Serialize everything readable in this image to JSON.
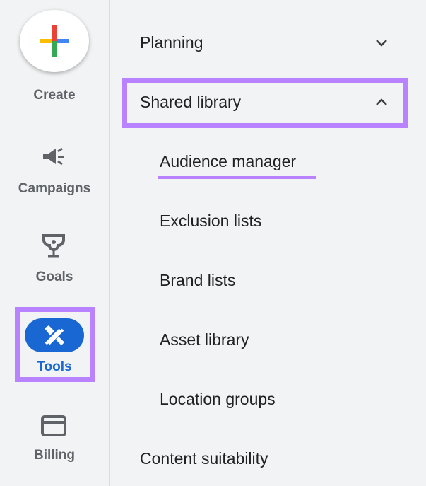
{
  "rail": {
    "create": "Create",
    "campaigns": "Campaigns",
    "goals": "Goals",
    "tools": "Tools",
    "billing": "Billing"
  },
  "menu": {
    "planning": "Planning",
    "shared_library": "Shared library",
    "sub": [
      "Audience manager",
      "Exclusion lists",
      "Brand lists",
      "Asset library",
      "Location groups"
    ],
    "content_suitability": "Content suitability"
  },
  "colors": {
    "highlight": "#b983ff",
    "active": "#1967d2"
  }
}
